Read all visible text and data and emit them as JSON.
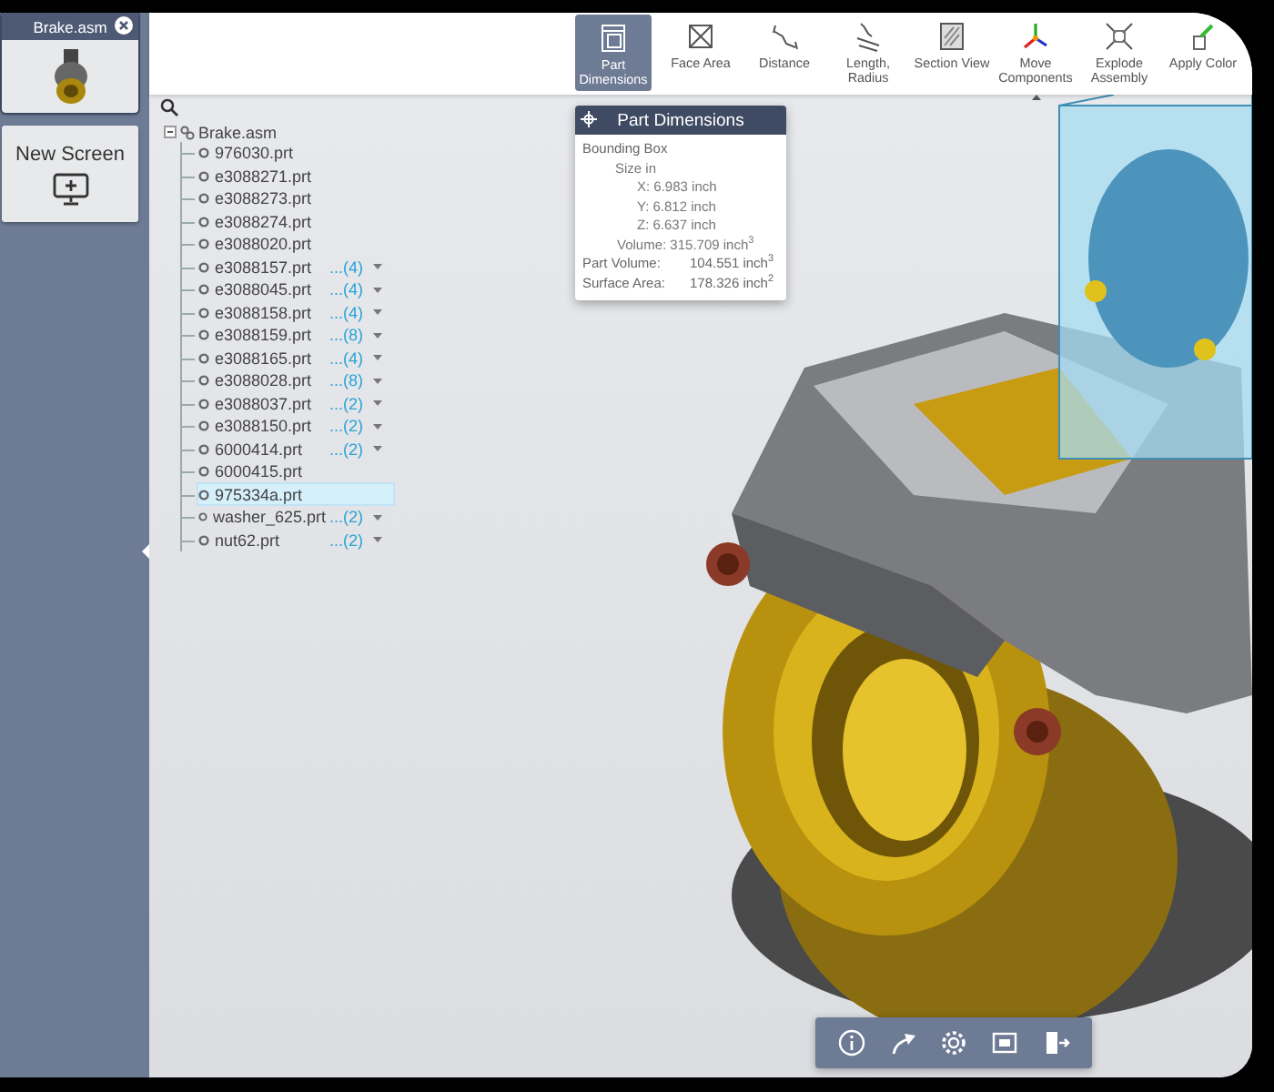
{
  "sidebar": {
    "screens": [
      {
        "kind": "model",
        "title": "Brake.asm",
        "selected": true
      },
      {
        "kind": "new",
        "title": "New Screen",
        "selected": false
      }
    ]
  },
  "toolbar": {
    "tools": [
      {
        "label": "Part Dimensions",
        "selected": true,
        "indicator": false
      },
      {
        "label": "Face Area",
        "selected": false,
        "indicator": false
      },
      {
        "label": "Distance",
        "selected": false,
        "indicator": false
      },
      {
        "label": "Length, Radius",
        "selected": false,
        "indicator": false
      },
      {
        "label": "Section View",
        "selected": false,
        "indicator": false
      },
      {
        "label": "Move Components",
        "selected": false,
        "indicator": true
      },
      {
        "label": "Explode Assembly",
        "selected": false,
        "indicator": false
      },
      {
        "label": "Apply Color",
        "selected": false,
        "indicator": false
      }
    ]
  },
  "tree": {
    "root": {
      "label": "Brake.asm",
      "expanded": true,
      "children": [
        {
          "label": "976030.prt",
          "selected": false
        },
        {
          "label": "e3088271.prt",
          "selected": false
        },
        {
          "label": "e3088273.prt",
          "selected": false
        },
        {
          "label": "e3088274.prt",
          "selected": false
        },
        {
          "label": "e3088020.prt",
          "selected": false
        },
        {
          "label": "e3088157.prt",
          "count": "...(4)",
          "selected": false
        },
        {
          "label": "e3088045.prt",
          "count": "...(4)",
          "selected": false
        },
        {
          "label": "e3088158.prt",
          "count": "...(4)",
          "selected": false
        },
        {
          "label": "e3088159.prt",
          "count": "...(8)",
          "selected": false
        },
        {
          "label": "e3088165.prt",
          "count": "...(4)",
          "selected": false
        },
        {
          "label": "e3088028.prt",
          "count": "...(8)",
          "selected": false
        },
        {
          "label": "e3088037.prt",
          "count": "...(2)",
          "selected": false
        },
        {
          "label": "e3088150.prt",
          "count": "...(2)",
          "selected": false
        },
        {
          "label": "6000414.prt",
          "count": "...(2)",
          "selected": false
        },
        {
          "label": "6000415.prt",
          "selected": false
        },
        {
          "label": "975334a.prt",
          "selected": true
        },
        {
          "label": "washer_625.prt",
          "count": "...(2)",
          "selected": false
        },
        {
          "label": "nut62.prt",
          "count": "...(2)",
          "selected": false
        }
      ]
    }
  },
  "popup": {
    "title": "Part Dimensions",
    "section": "Bounding Box",
    "subsection": "Size in",
    "axes": [
      "X: 6.983 inch",
      "Y: 6.812 inch",
      "Z: 6.637 inch"
    ],
    "volume": "Volume: 315.709 inch$^{3}$",
    "rows": [
      {
        "label": "Part Volume:",
        "value": "104.551 inch$^{3}$"
      },
      {
        "label": "Surface Area:",
        "value": "178.326 inch$^{2}$"
      }
    ]
  }
}
